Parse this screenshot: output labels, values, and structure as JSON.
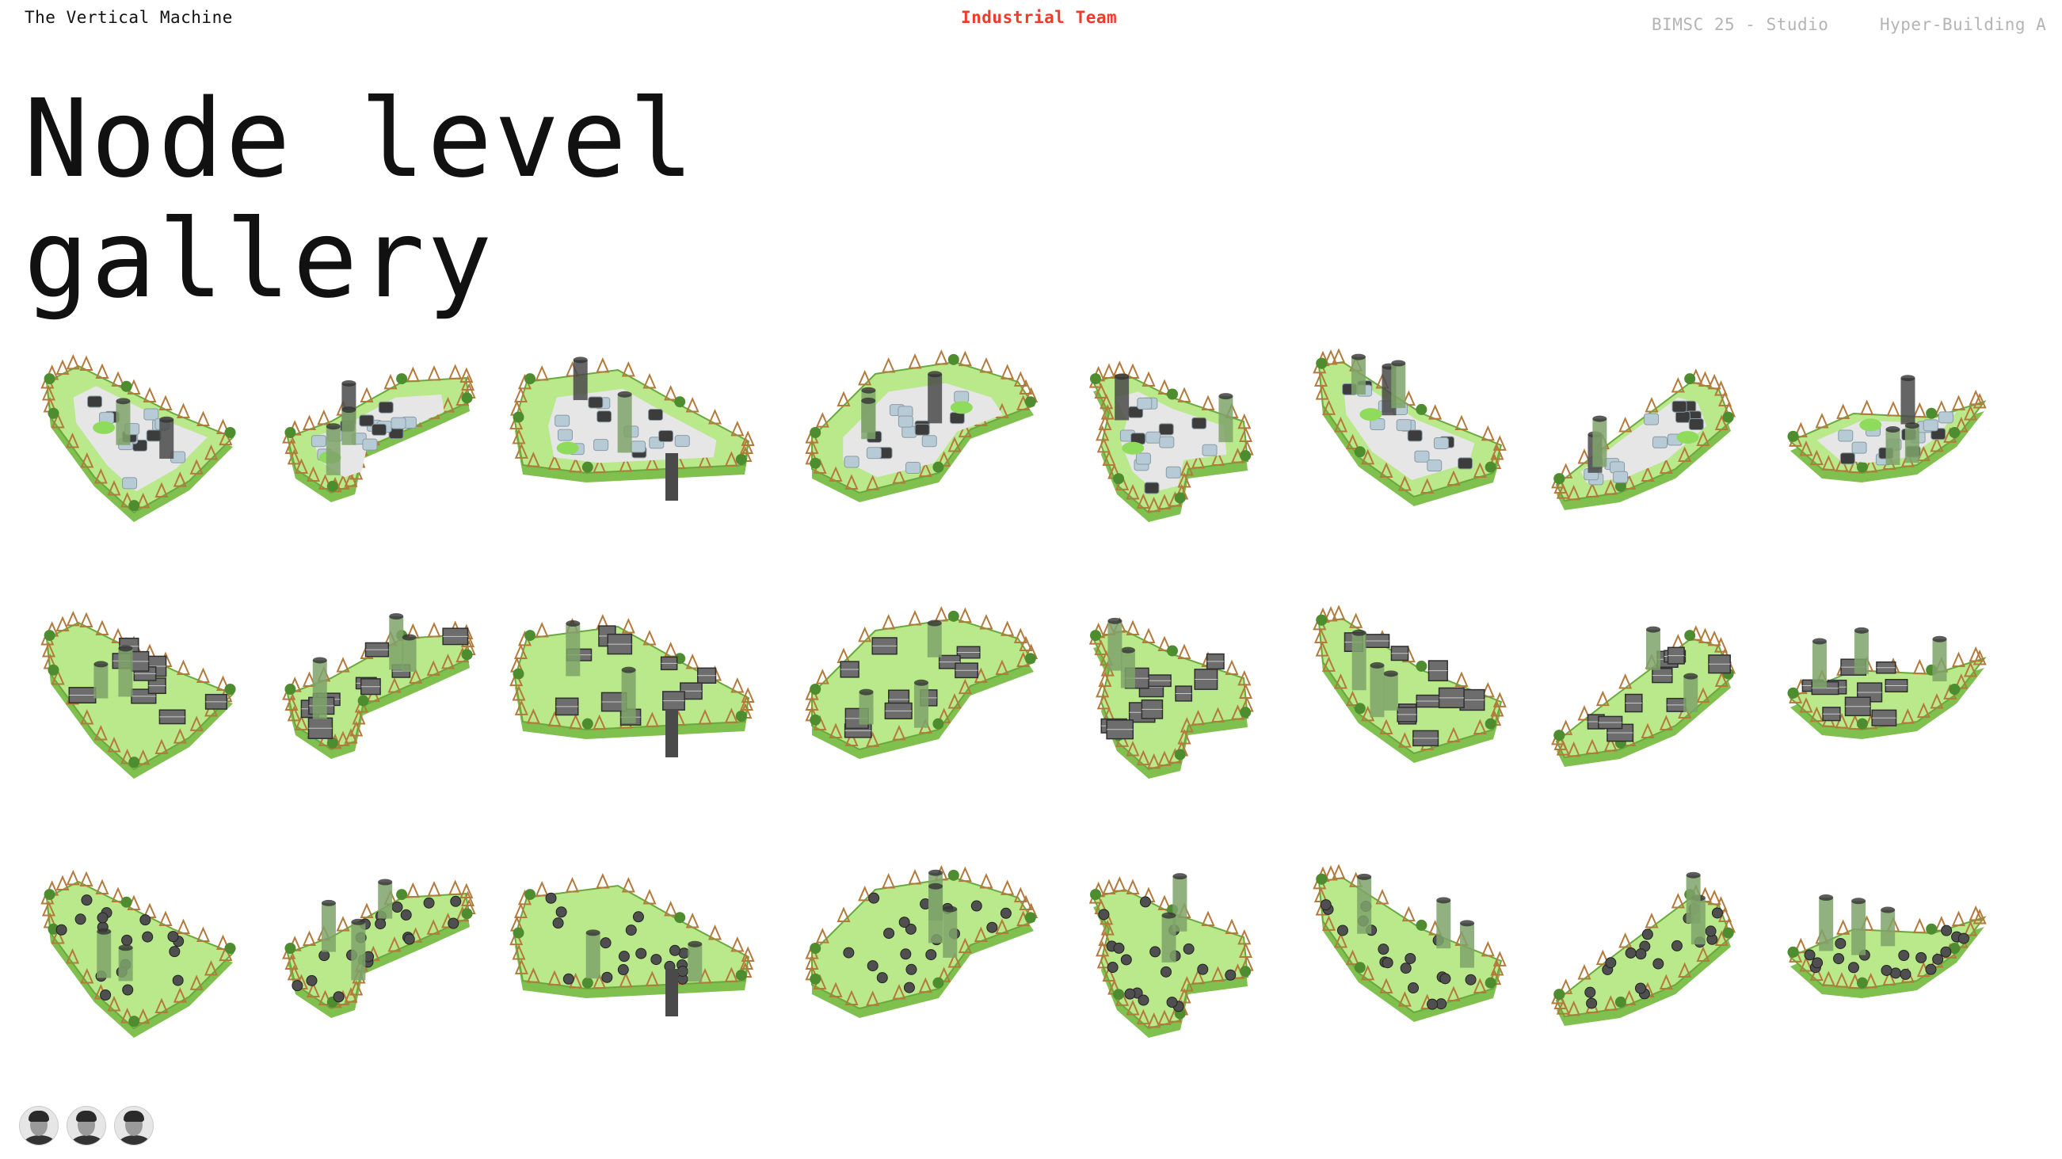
{
  "header": {
    "project": "The Vertical Machine",
    "team": "Industrial Team",
    "course": "BIMSC 25 - Studio",
    "building": "Hyper-Building A"
  },
  "title": {
    "line1": "Node level",
    "line2": "gallery"
  },
  "gallery": {
    "rows": 3,
    "columns": 8,
    "row_themes": [
      "mixed-program",
      "block-modules",
      "round-modules"
    ]
  },
  "colors": {
    "accent": "#ee3b2a",
    "muted": "#b4b4b4",
    "platform_green": "#b9e98a",
    "platform_edge": "#7fc04f",
    "plaza": "#e6e6e6",
    "tower": "#4a4a4a",
    "glass_cluster": "#b7cbd6",
    "roof_truss": "#b37a3c"
  },
  "team": {
    "members": [
      "member-1",
      "member-2",
      "member-3"
    ]
  }
}
